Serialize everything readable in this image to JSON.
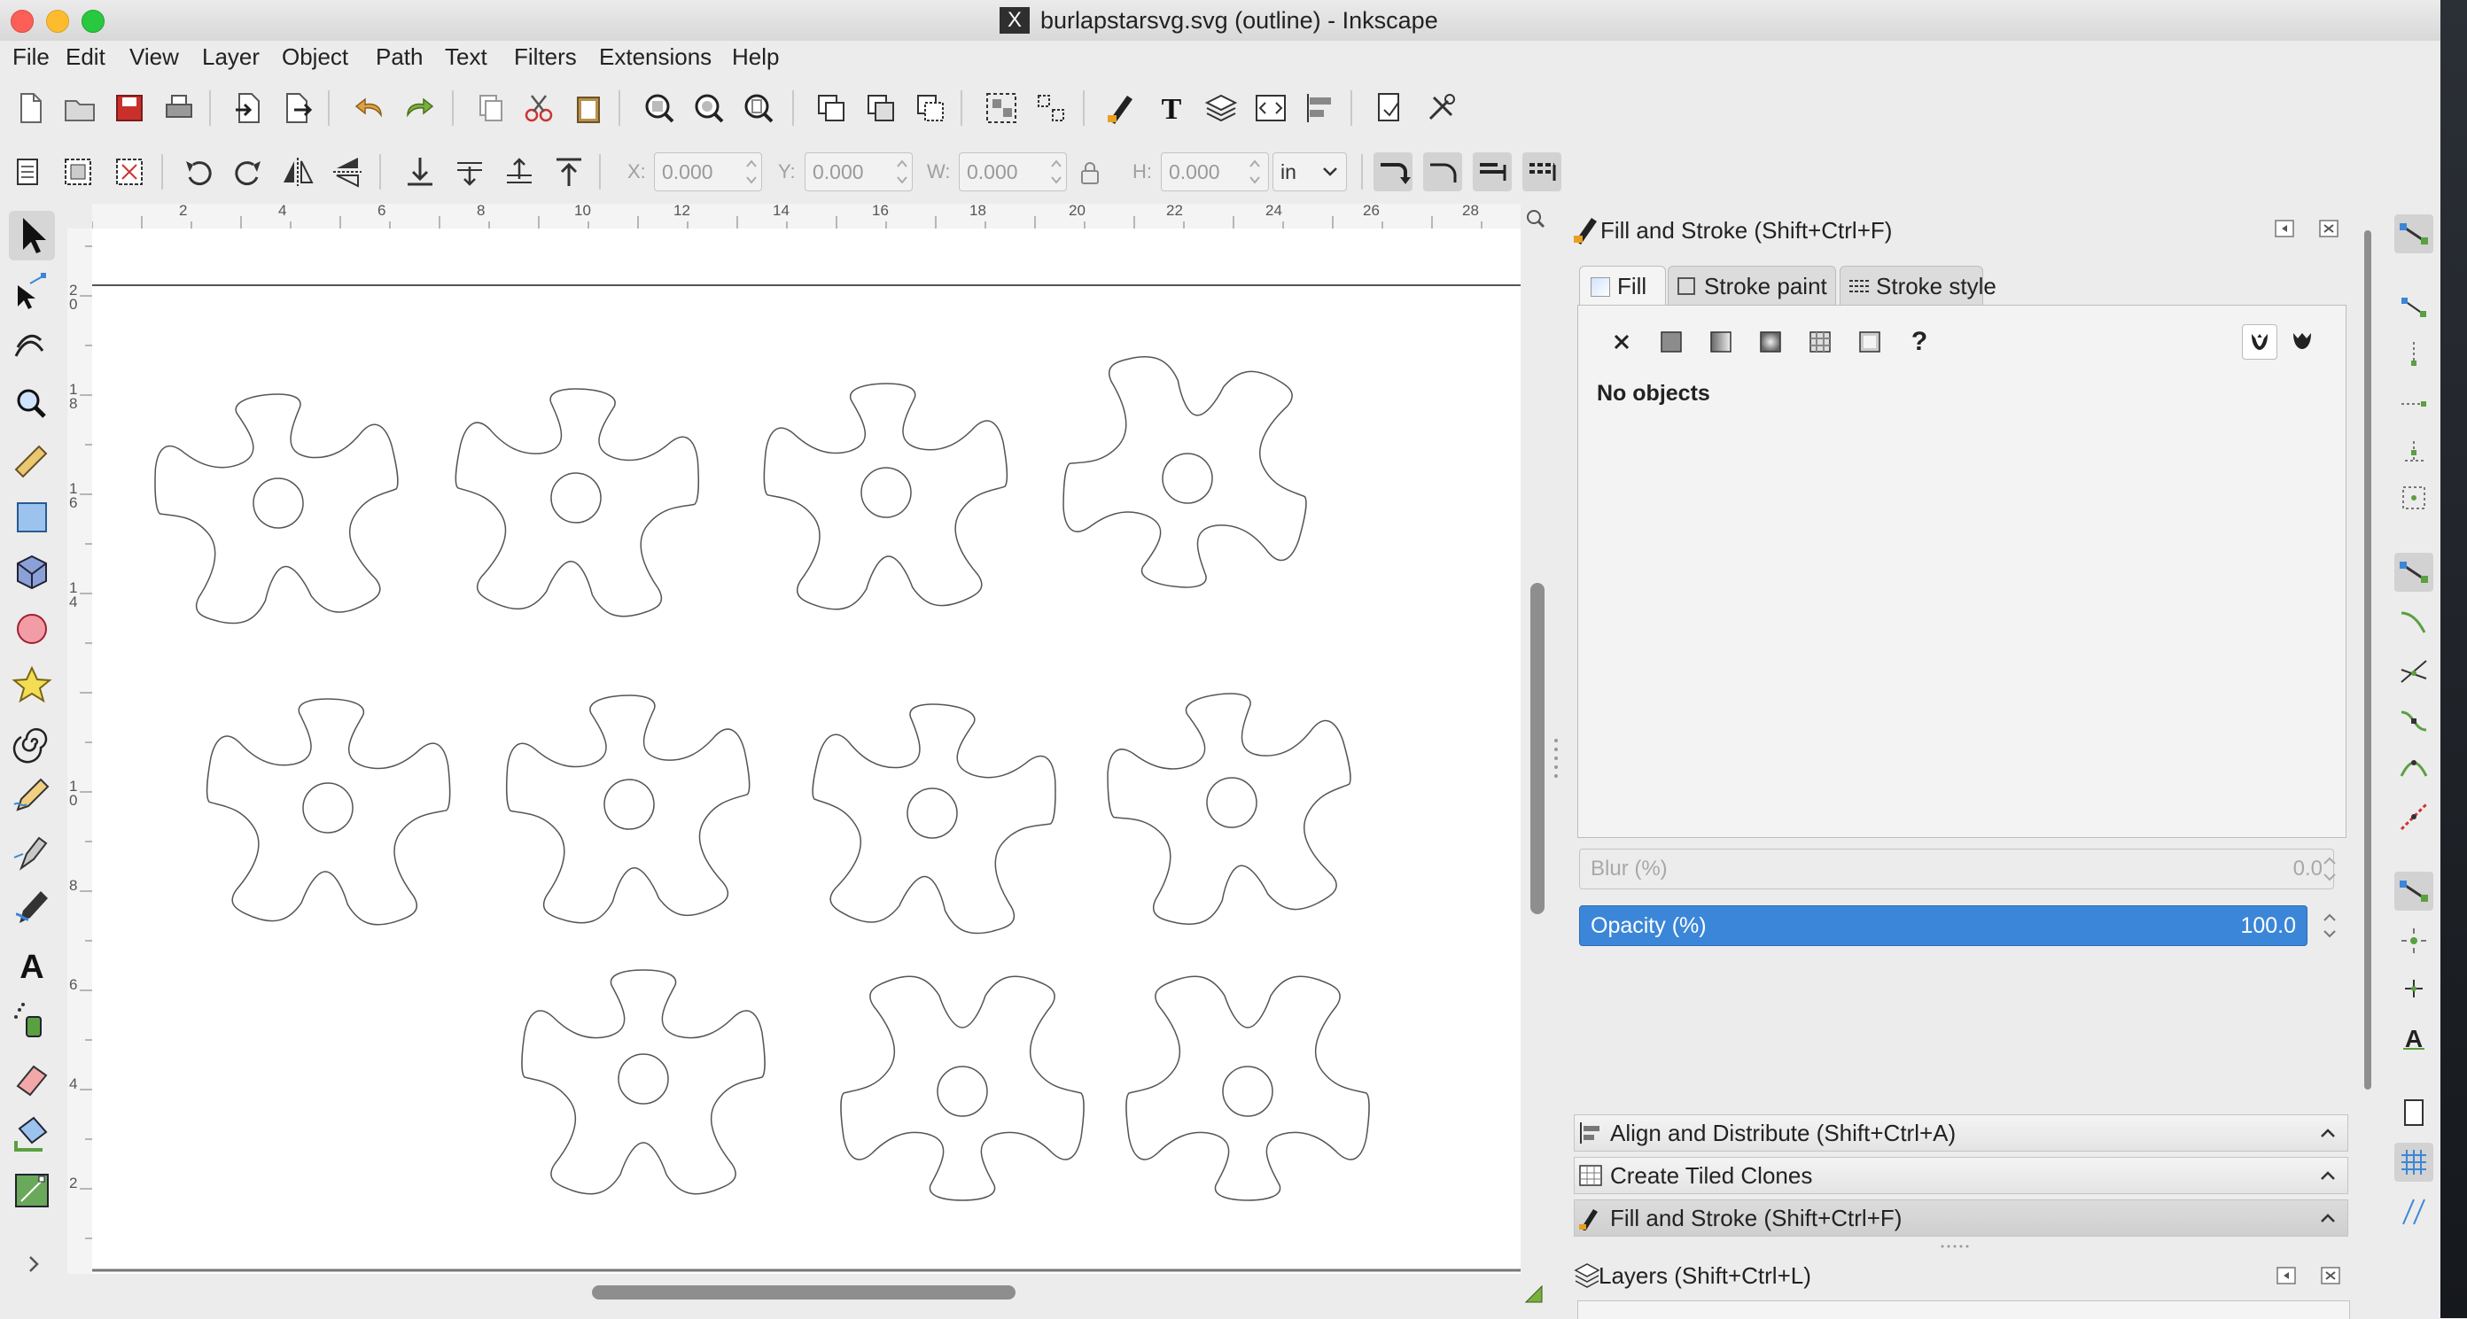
{
  "window": {
    "title": "burlapstarsvg.svg (outline) - Inkscape",
    "title_icon": "X"
  },
  "menubar": [
    "File",
    "Edit",
    "View",
    "Layer",
    "Object",
    "Path",
    "Text",
    "Filters",
    "Extensions",
    "Help"
  ],
  "select_toolbar": {
    "x_label": "X:",
    "x_value": "0.000",
    "y_label": "Y:",
    "y_value": "0.000",
    "w_label": "W:",
    "w_value": "0.000",
    "h_label": "H:",
    "h_value": "0.000",
    "unit": "in"
  },
  "ruler": {
    "top_ticks": [
      "2",
      "4",
      "6",
      "8",
      "10",
      "12",
      "14",
      "16",
      "18",
      "20",
      "22",
      "24",
      "26",
      "28"
    ],
    "left_ticks": [
      "20",
      "18",
      "16",
      "14",
      "10",
      "8",
      "6",
      "4",
      "2"
    ]
  },
  "fill_stroke": {
    "title": "Fill and Stroke (Shift+Ctrl+F)",
    "tabs": [
      "Fill",
      "Stroke paint",
      "Stroke style"
    ],
    "active_tab": "Fill",
    "paint_types": [
      "no-paint",
      "flat-color",
      "linear-gradient",
      "radial-gradient",
      "pattern",
      "swatch",
      "unset"
    ],
    "unset_glyph": "?",
    "status": "No objects",
    "blur_label": "Blur (%)",
    "blur_value": "0.0",
    "opacity_label": "Opacity (%)",
    "opacity_value": "100.0"
  },
  "collapsed_panels": [
    {
      "label": "Align and Distribute (Shift+Ctrl+A)"
    },
    {
      "label": "Create Tiled Clones"
    },
    {
      "label": "Fill and Stroke (Shift+Ctrl+F)"
    }
  ],
  "layers_panel": {
    "title": "Layers (Shift+Ctrl+L)"
  },
  "colors": {
    "accent": "#3b86d8",
    "canvas": "#ffffff",
    "outline": "#555555",
    "close": "#fc5f57",
    "minimize": "#fdbc2e",
    "zoom": "#28c840"
  }
}
